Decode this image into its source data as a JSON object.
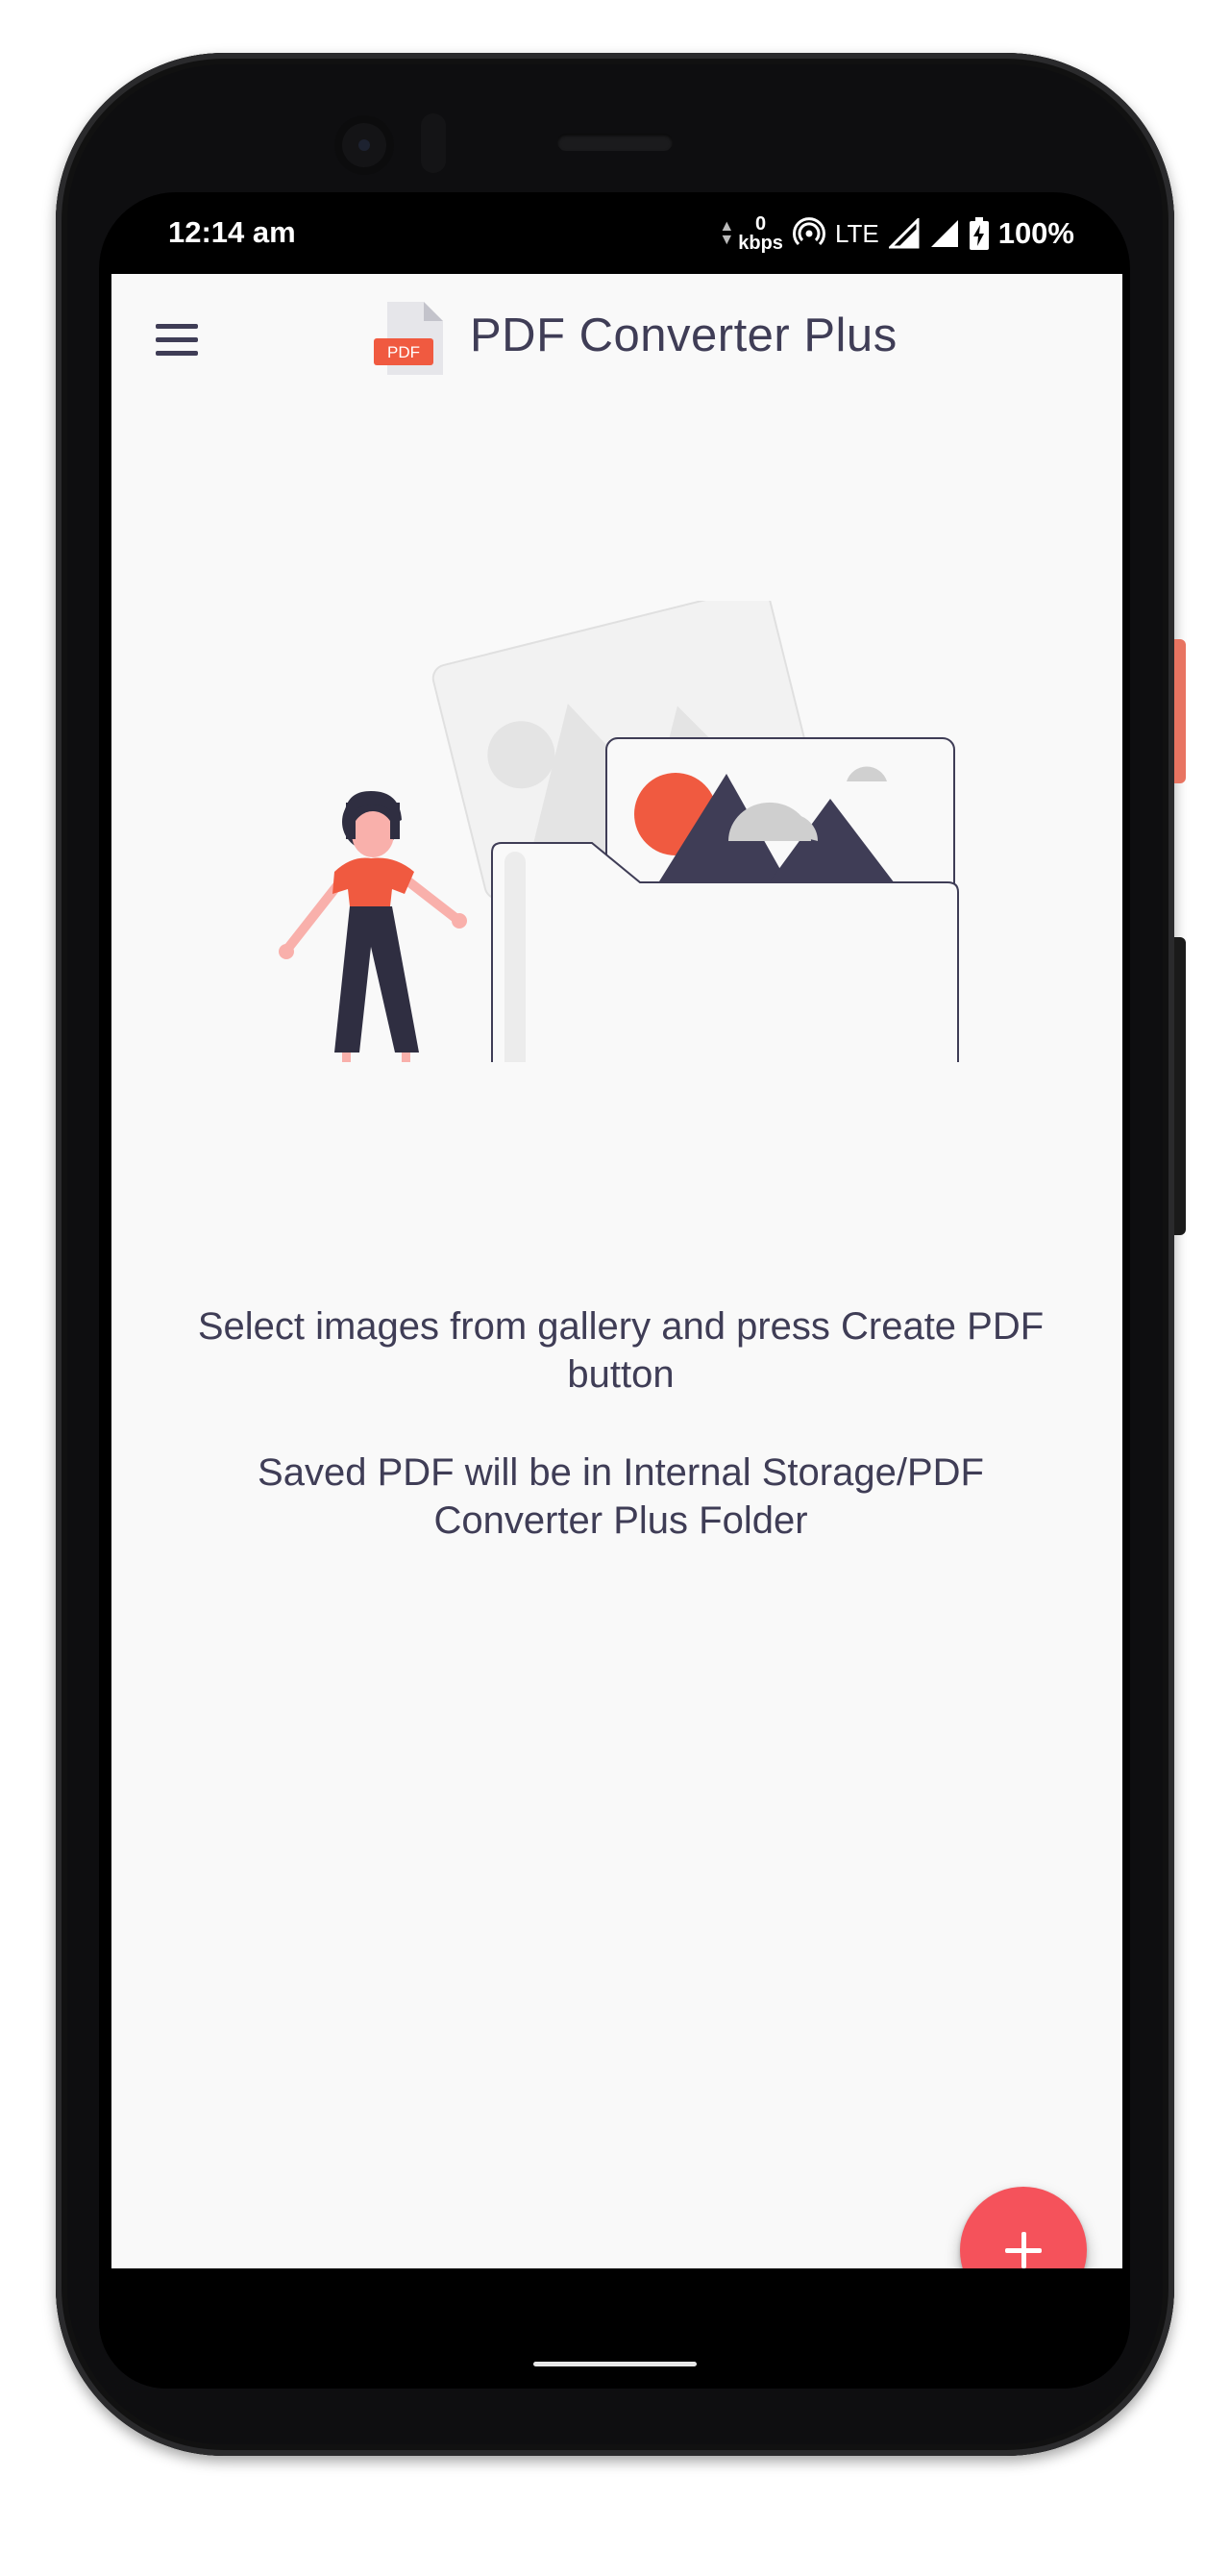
{
  "status_bar": {
    "time": "12:14 am",
    "data_speed_value": "0",
    "data_speed_unit": "kbps",
    "network": "LTE",
    "battery": "100%"
  },
  "app_bar": {
    "logo_label": "PDF",
    "title": "PDF Converter Plus"
  },
  "empty_state": {
    "line1": "Select images from gallery and press Create PDF button",
    "line2": "Saved PDF will be in Internal Storage/PDF Converter Plus Folder"
  },
  "icons": [
    "menu-icon",
    "pdf-file-icon",
    "add-icon",
    "hotspot-icon",
    "signal-icon",
    "battery-charging-icon"
  ],
  "colors": {
    "accent": "#f5525b",
    "text": "#3f3d56",
    "background": "#f9f9f9",
    "illustration_red": "#f05a40"
  }
}
